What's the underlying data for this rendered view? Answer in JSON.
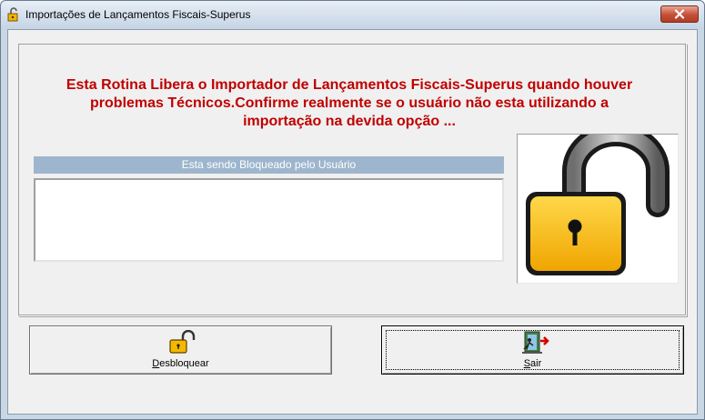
{
  "window": {
    "title": "Importações de Lançamentos Fiscais-Superus",
    "icon": "padlock-icon",
    "close_icon": "close-icon"
  },
  "warning": {
    "line1": "Esta Rotina Libera o Importador de Lançamentos Fiscais-Superus quando houver",
    "line2": "problemas Técnicos.Confirme realmente se  o usuário não esta utilizando a",
    "line3": "importação na devida opção ...",
    "color": "#c00000"
  },
  "users_panel": {
    "header": "Esta sendo Bloqueado pelo Usuário",
    "items": []
  },
  "lock_image": {
    "icon": "open-padlock-icon"
  },
  "buttons": {
    "desbloquear": {
      "mnemonic": "D",
      "rest": "esbloquear",
      "icon": "open-padlock-icon"
    },
    "sair": {
      "mnemonic": "S",
      "rest": "air",
      "icon": "exit-door-icon"
    }
  }
}
